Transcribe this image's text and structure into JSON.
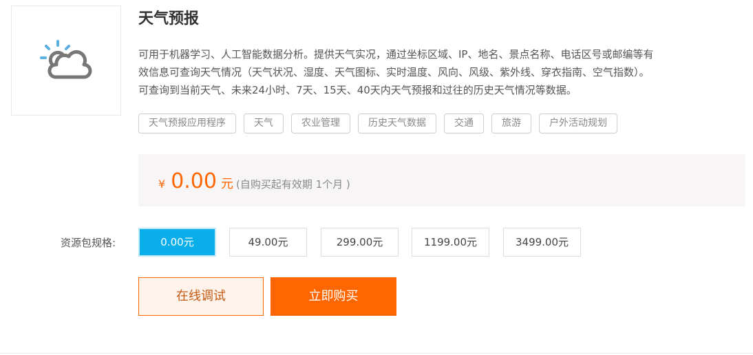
{
  "product": {
    "title": "天气预报",
    "icon": "partly-cloudy-icon",
    "description": [
      "可用于机器学习、人工智能数据分析。提供天气实况，通过坐标区域、IP、地名、景点名称、电话区号或邮编等有",
      "效信息可查询天气情况（天气状况、湿度、天气图标、实时温度、风向、风级、紫外线、穿衣指南、空气指数）。",
      "可查询到当前天气、未来24小时、7天、15天、40天内天气预报和过往的历史天气情况等数据。"
    ],
    "tags": [
      "天气预报应用程序",
      "天气",
      "农业管理",
      "历史天气数据",
      "交通",
      "旅游",
      "户外活动规划"
    ]
  },
  "price": {
    "currency": "¥",
    "amount": "0.00",
    "unit": "元",
    "note": "(自购买起有效期 1个月 )"
  },
  "specs": {
    "label": "资源包规格:",
    "options": [
      "0.00元",
      "49.00元",
      "299.00元",
      "1199.00元",
      "3499.00元"
    ],
    "selected": "0.00元"
  },
  "actions": {
    "try": "在线调试",
    "buy": "立即购买"
  },
  "colors": {
    "accent": "#ff6600",
    "selected": "#0aaeea"
  }
}
